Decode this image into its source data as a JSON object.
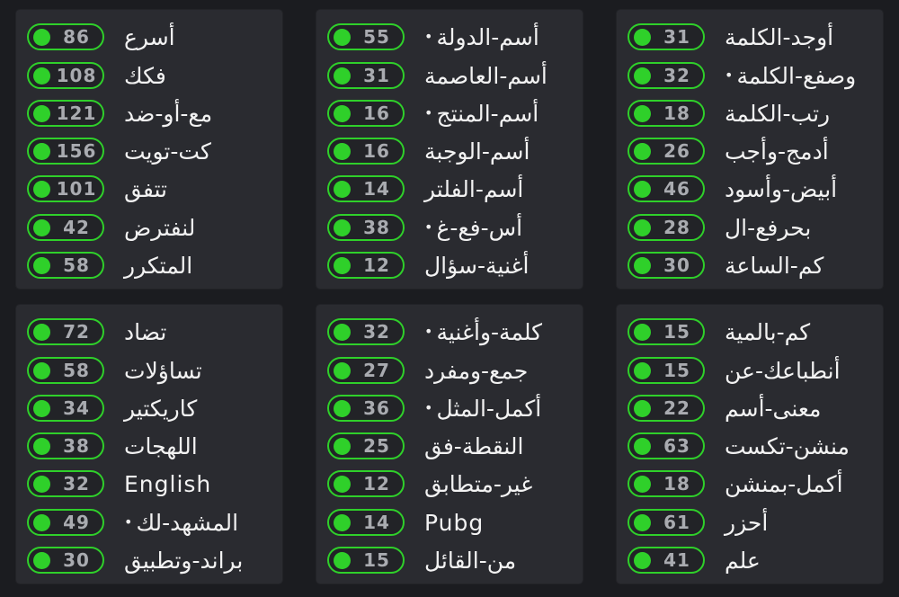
{
  "panels": [
    {
      "id": "top-left",
      "items": [
        {
          "count": "86",
          "label": "أسرع",
          "marked": false
        },
        {
          "count": "108",
          "label": "فكك",
          "marked": false
        },
        {
          "count": "121",
          "label": "مع-أو-ضد",
          "marked": false
        },
        {
          "count": "156",
          "label": "كت-تويت",
          "marked": false
        },
        {
          "count": "101",
          "label": "تتفق",
          "marked": false
        },
        {
          "count": "42",
          "label": "لنفترض",
          "marked": false
        },
        {
          "count": "58",
          "label": "المتكرر",
          "marked": false
        }
      ]
    },
    {
      "id": "top-middle",
      "items": [
        {
          "count": "55",
          "label": "أسم-الدولة",
          "marked": true
        },
        {
          "count": "31",
          "label": "أسم-العاصمة",
          "marked": false
        },
        {
          "count": "16",
          "label": "أسم-المنتج",
          "marked": true
        },
        {
          "count": "16",
          "label": "أسم-الوجبة",
          "marked": false
        },
        {
          "count": "14",
          "label": "أسم-الفلتر",
          "marked": false
        },
        {
          "count": "38",
          "label": "أس-فع-غ",
          "marked": true
        },
        {
          "count": "12",
          "label": "أغنية-سؤال",
          "marked": false
        }
      ]
    },
    {
      "id": "top-right",
      "items": [
        {
          "count": "31",
          "label": "أوجد-الكلمة",
          "marked": false
        },
        {
          "count": "32",
          "label": "وصفع-الكلمة",
          "marked": true
        },
        {
          "count": "18",
          "label": "رتب-الكلمة",
          "marked": false
        },
        {
          "count": "26",
          "label": "أدمج-وأجب",
          "marked": false
        },
        {
          "count": "46",
          "label": "أبيض-وأسود",
          "marked": false
        },
        {
          "count": "28",
          "label": "بحرفع-ال",
          "marked": false
        },
        {
          "count": "30",
          "label": "كم-الساعة",
          "marked": false
        }
      ]
    },
    {
      "id": "bottom-left",
      "items": [
        {
          "count": "72",
          "label": "تضاد",
          "marked": false
        },
        {
          "count": "58",
          "label": "تساؤلات",
          "marked": false
        },
        {
          "count": "34",
          "label": "كاريكتير",
          "marked": false
        },
        {
          "count": "38",
          "label": "اللهجات",
          "marked": false
        },
        {
          "count": "32",
          "label": "English",
          "marked": false
        },
        {
          "count": "49",
          "label": "المشهد-لك",
          "marked": true
        },
        {
          "count": "30",
          "label": "براند-وتطبيق",
          "marked": false
        }
      ]
    },
    {
      "id": "bottom-middle",
      "items": [
        {
          "count": "32",
          "label": "كلمة-وأغنية",
          "marked": true
        },
        {
          "count": "27",
          "label": "جمع-ومفرد",
          "marked": false
        },
        {
          "count": "36",
          "label": "أكمل-المثل",
          "marked": true
        },
        {
          "count": "25",
          "label": "النقطة-فق",
          "marked": false
        },
        {
          "count": "12",
          "label": "غير-متطابق",
          "marked": false
        },
        {
          "count": "14",
          "label": "Pubg",
          "marked": false
        },
        {
          "count": "15",
          "label": "من-القائل",
          "marked": false
        }
      ]
    },
    {
      "id": "bottom-right",
      "items": [
        {
          "count": "15",
          "label": "كم-بالمية",
          "marked": false
        },
        {
          "count": "15",
          "label": "أنطباعك-عن",
          "marked": false
        },
        {
          "count": "22",
          "label": "معنى-أسم",
          "marked": false
        },
        {
          "count": "63",
          "label": "منشن-تكست",
          "marked": false
        },
        {
          "count": "18",
          "label": "أكمل-بمنشن",
          "marked": false
        },
        {
          "count": "61",
          "label": "أحزر",
          "marked": false
        },
        {
          "count": "41",
          "label": "علم",
          "marked": false
        }
      ]
    }
  ],
  "marker_glyph": "•",
  "colors": {
    "background": "#1b1c20",
    "panel": "#2a2b30",
    "accent_green": "#2fd02a",
    "count_text": "#a9abb0",
    "label_text": "#f2f2f2"
  },
  "icons": {
    "status_dot": "green-status-dot-icon"
  }
}
